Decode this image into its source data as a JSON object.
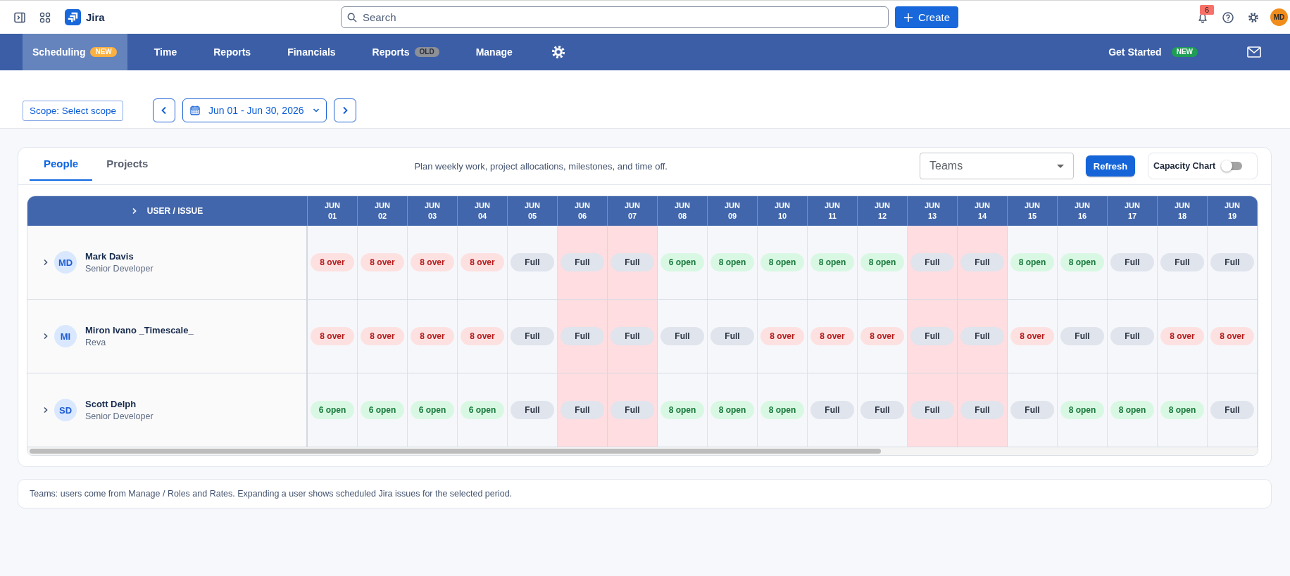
{
  "topbar": {
    "app_name": "Jira",
    "search": {
      "placeholder": "Search"
    },
    "create_button": "Create",
    "notification_count": "6",
    "avatar": "MD"
  },
  "nav": {
    "items": [
      {
        "label": "Scheduling",
        "selected": true,
        "badge": {
          "text": "NEW",
          "color": "#fbb040"
        }
      },
      {
        "label": "Time",
        "selected": false
      },
      {
        "label": "Reports",
        "selected": false
      },
      {
        "label": "Financials",
        "selected": false
      },
      {
        "label": "Reports",
        "selected": false,
        "badge": {
          "text": "OLD",
          "color": "#8d9097"
        }
      },
      {
        "label": "Manage",
        "selected": false
      }
    ],
    "get_started": {
      "label": "Get Started",
      "badge": {
        "text": "NEW",
        "color": "#1f9d55"
      }
    }
  },
  "toolbar": {
    "scope_button": "Scope: Select scope",
    "date_range": "Jun 01 - Jun 30, 2026"
  },
  "panel": {
    "tabs": [
      {
        "label": "People",
        "selected": true
      },
      {
        "label": "Projects",
        "selected": false
      }
    ],
    "description": "Plan weekly work, project allocations, milestones, and time off.",
    "teams_select": {
      "placeholder": "Teams"
    },
    "refresh_button": "Refresh",
    "capacity_chart": {
      "label": "Capacity Chart",
      "on": false
    }
  },
  "table": {
    "first_column": "USER / ISSUE",
    "columns": [
      {
        "month": "JUN",
        "day": "01",
        "weekend": false
      },
      {
        "month": "JUN",
        "day": "02",
        "weekend": false
      },
      {
        "month": "JUN",
        "day": "03",
        "weekend": false
      },
      {
        "month": "JUN",
        "day": "04",
        "weekend": false
      },
      {
        "month": "JUN",
        "day": "05",
        "weekend": false
      },
      {
        "month": "JUN",
        "day": "06",
        "weekend": true
      },
      {
        "month": "JUN",
        "day": "07",
        "weekend": true
      },
      {
        "month": "JUN",
        "day": "08",
        "weekend": false
      },
      {
        "month": "JUN",
        "day": "09",
        "weekend": false
      },
      {
        "month": "JUN",
        "day": "10",
        "weekend": false
      },
      {
        "month": "JUN",
        "day": "11",
        "weekend": false
      },
      {
        "month": "JUN",
        "day": "12",
        "weekend": false
      },
      {
        "month": "JUN",
        "day": "13",
        "weekend": true
      },
      {
        "month": "JUN",
        "day": "14",
        "weekend": true
      },
      {
        "month": "JUN",
        "day": "15",
        "weekend": false
      },
      {
        "month": "JUN",
        "day": "16",
        "weekend": false
      },
      {
        "month": "JUN",
        "day": "17",
        "weekend": false
      },
      {
        "month": "JUN",
        "day": "18",
        "weekend": false
      },
      {
        "month": "JUN",
        "day": "19",
        "weekend": false
      }
    ],
    "rows": [
      {
        "initials": "MD",
        "name": "Mark Davis",
        "role": "Senior Developer",
        "expanded": false,
        "cells": [
          {
            "kind": "over",
            "text": "8 over"
          },
          {
            "kind": "over",
            "text": "8 over"
          },
          {
            "kind": "over",
            "text": "8 over"
          },
          {
            "kind": "over",
            "text": "8 over"
          },
          {
            "kind": "full",
            "text": "Full"
          },
          {
            "kind": "full",
            "text": "Full"
          },
          {
            "kind": "full",
            "text": "Full"
          },
          {
            "kind": "open",
            "text": "6 open"
          },
          {
            "kind": "open",
            "text": "8 open"
          },
          {
            "kind": "open",
            "text": "8 open"
          },
          {
            "kind": "open",
            "text": "8 open"
          },
          {
            "kind": "open",
            "text": "8 open"
          },
          {
            "kind": "full",
            "text": "Full"
          },
          {
            "kind": "full",
            "text": "Full"
          },
          {
            "kind": "open",
            "text": "8 open"
          },
          {
            "kind": "open",
            "text": "8 open"
          },
          {
            "kind": "full",
            "text": "Full"
          },
          {
            "kind": "full",
            "text": "Full"
          },
          {
            "kind": "full",
            "text": "Full"
          }
        ]
      },
      {
        "initials": "MI",
        "name": "Miron Ivano _Timescale_",
        "role": "Reva",
        "expanded": false,
        "cells": [
          {
            "kind": "over",
            "text": "8 over"
          },
          {
            "kind": "over",
            "text": "8 over"
          },
          {
            "kind": "over",
            "text": "8 over"
          },
          {
            "kind": "over",
            "text": "8 over"
          },
          {
            "kind": "full",
            "text": "Full"
          },
          {
            "kind": "full",
            "text": "Full"
          },
          {
            "kind": "full",
            "text": "Full"
          },
          {
            "kind": "full",
            "text": "Full"
          },
          {
            "kind": "full",
            "text": "Full"
          },
          {
            "kind": "over",
            "text": "8 over"
          },
          {
            "kind": "over",
            "text": "8 over"
          },
          {
            "kind": "over",
            "text": "8 over"
          },
          {
            "kind": "full",
            "text": "Full"
          },
          {
            "kind": "full",
            "text": "Full"
          },
          {
            "kind": "over",
            "text": "8 over"
          },
          {
            "kind": "full",
            "text": "Full"
          },
          {
            "kind": "full",
            "text": "Full"
          },
          {
            "kind": "over",
            "text": "8 over"
          },
          {
            "kind": "over",
            "text": "8 over"
          }
        ]
      },
      {
        "initials": "SD",
        "name": "Scott Delph",
        "role": "Senior Developer",
        "expanded": false,
        "cells": [
          {
            "kind": "open",
            "text": "6 open"
          },
          {
            "kind": "open",
            "text": "6 open"
          },
          {
            "kind": "open",
            "text": "6 open"
          },
          {
            "kind": "open",
            "text": "6 open"
          },
          {
            "kind": "full",
            "text": "Full"
          },
          {
            "kind": "full",
            "text": "Full"
          },
          {
            "kind": "full",
            "text": "Full"
          },
          {
            "kind": "open",
            "text": "8 open"
          },
          {
            "kind": "open",
            "text": "8 open"
          },
          {
            "kind": "open",
            "text": "8 open"
          },
          {
            "kind": "full",
            "text": "Full"
          },
          {
            "kind": "full",
            "text": "Full"
          },
          {
            "kind": "full",
            "text": "Full"
          },
          {
            "kind": "full",
            "text": "Full"
          },
          {
            "kind": "full",
            "text": "Full"
          },
          {
            "kind": "open",
            "text": "8 open"
          },
          {
            "kind": "open",
            "text": "8 open"
          },
          {
            "kind": "open",
            "text": "8 open"
          },
          {
            "kind": "full",
            "text": "Full"
          }
        ]
      }
    ]
  },
  "footer_note": "Teams: users come from Manage / Roles and Rates. Expanding a user shows scheduled Jira issues for the selected period."
}
